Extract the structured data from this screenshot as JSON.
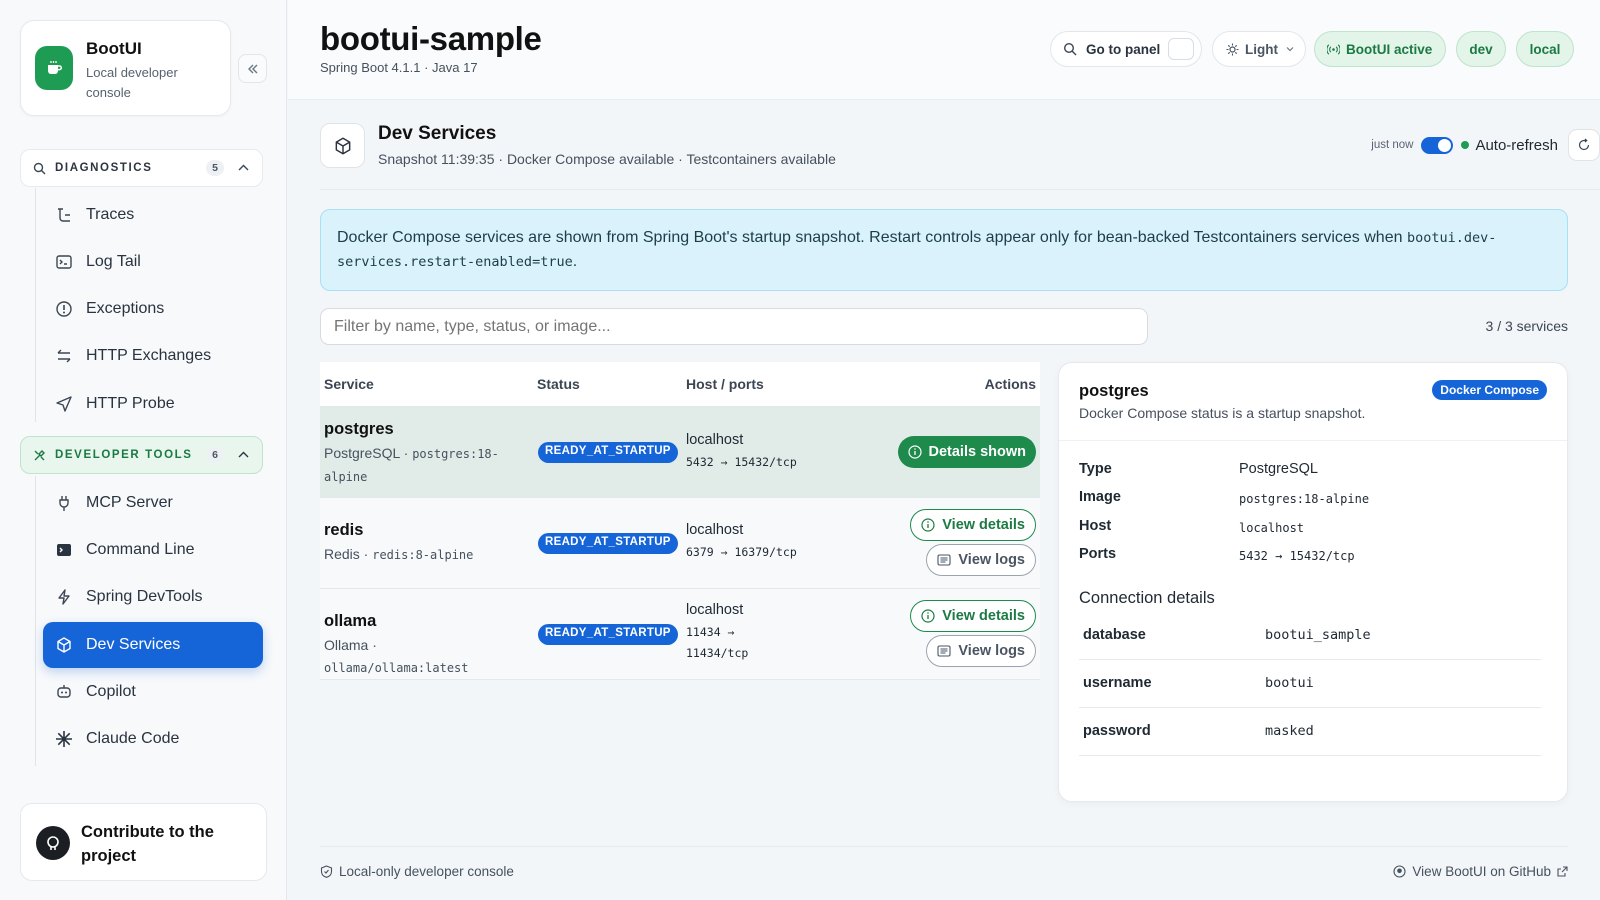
{
  "brand": {
    "title": "BootUI",
    "subtitle": "Local developer console"
  },
  "sidebar": {
    "diagnostics": {
      "label": "DIAGNOSTICS",
      "count": "5",
      "items": [
        {
          "label": "Traces",
          "icon": "traces-icon"
        },
        {
          "label": "Log Tail",
          "icon": "terminal-icon"
        },
        {
          "label": "Exceptions",
          "icon": "alert-circle-icon"
        },
        {
          "label": "HTTP Exchanges",
          "icon": "arrows-exchange-icon"
        },
        {
          "label": "HTTP Probe",
          "icon": "send-icon"
        }
      ]
    },
    "devtools": {
      "label": "DEVELOPER TOOLS",
      "count": "6",
      "items": [
        {
          "label": "MCP Server",
          "icon": "plug-icon"
        },
        {
          "label": "Command Line",
          "icon": "command-line-icon"
        },
        {
          "label": "Spring DevTools",
          "icon": "bolt-icon"
        },
        {
          "label": "Dev Services",
          "icon": "cube-icon",
          "active": true
        },
        {
          "label": "Copilot",
          "icon": "robot-icon"
        },
        {
          "label": "Claude Code",
          "icon": "sparkle-icon"
        }
      ]
    },
    "contribute": "Contribute to the project"
  },
  "header": {
    "title": "bootui-sample",
    "subtitle": "Spring Boot 4.1.1 · Java 17",
    "search_label": "Go to panel",
    "theme_label": "Light",
    "status_label": "BootUI active",
    "tags": [
      "dev",
      "local"
    ]
  },
  "section": {
    "title": "Dev Services",
    "subtitle": "Snapshot 11:39:35 · Docker Compose available · Testcontainers available",
    "refreshed": "just now",
    "auto_refresh_label": "Auto-refresh",
    "auto_refresh_on": true
  },
  "banner": {
    "text": "Docker Compose services are shown from Spring Boot's startup snapshot. Restart controls appear only for bean-backed Testcontainers services when ",
    "code": "bootui.dev-services.restart-enabled=true",
    "end": "."
  },
  "filter": {
    "placeholder": "Filter by name, type, status, or image...",
    "count": "3 / 3 services"
  },
  "table": {
    "headers": {
      "service": "Service",
      "status": "Status",
      "host": "Host / ports",
      "actions": "Actions"
    },
    "rows": [
      {
        "name": "postgres",
        "type": "PostgreSQL · ",
        "image": "postgres:18-alpine",
        "status": "READY_AT_STARTUP",
        "host": "localhost",
        "ports": "5432 → 15432/tcp",
        "primary_action": "Details shown"
      },
      {
        "name": "redis",
        "type": "Redis · ",
        "image": "redis:8-alpine",
        "status": "READY_AT_STARTUP",
        "host": "localhost",
        "ports": "6379 → 16379/tcp",
        "primary_action": "View details",
        "secondary_action": "View logs"
      },
      {
        "name": "ollama",
        "type": "Ollama · ",
        "image": "ollama/ollama:latest",
        "status": "READY_AT_STARTUP",
        "host": "localhost",
        "ports_a": "11434 →",
        "ports_b": "11434/tcp",
        "primary_action": "View details",
        "secondary_action": "View logs"
      }
    ]
  },
  "detail": {
    "title": "postgres",
    "subtitle": "Docker Compose status is a startup snapshot.",
    "badge": "Docker Compose",
    "fields": [
      {
        "label": "Type",
        "value": "PostgreSQL"
      },
      {
        "label": "Image",
        "value": "postgres:18-alpine"
      },
      {
        "label": "Host",
        "value": "localhost"
      },
      {
        "label": "Ports",
        "value": "5432 → 15432/tcp"
      }
    ],
    "connection_title": "Connection details",
    "connection": [
      {
        "key": "database",
        "value": "bootui_sample"
      },
      {
        "key": "username",
        "value": "bootui"
      },
      {
        "key": "password",
        "value": "masked"
      }
    ]
  },
  "footer": {
    "left": "Local-only developer console",
    "right": "View BootUI on GitHub"
  },
  "colors": {
    "accent": "#1565d8",
    "green": "#1e8a4c",
    "banner_bg": "#d9f2fb"
  }
}
